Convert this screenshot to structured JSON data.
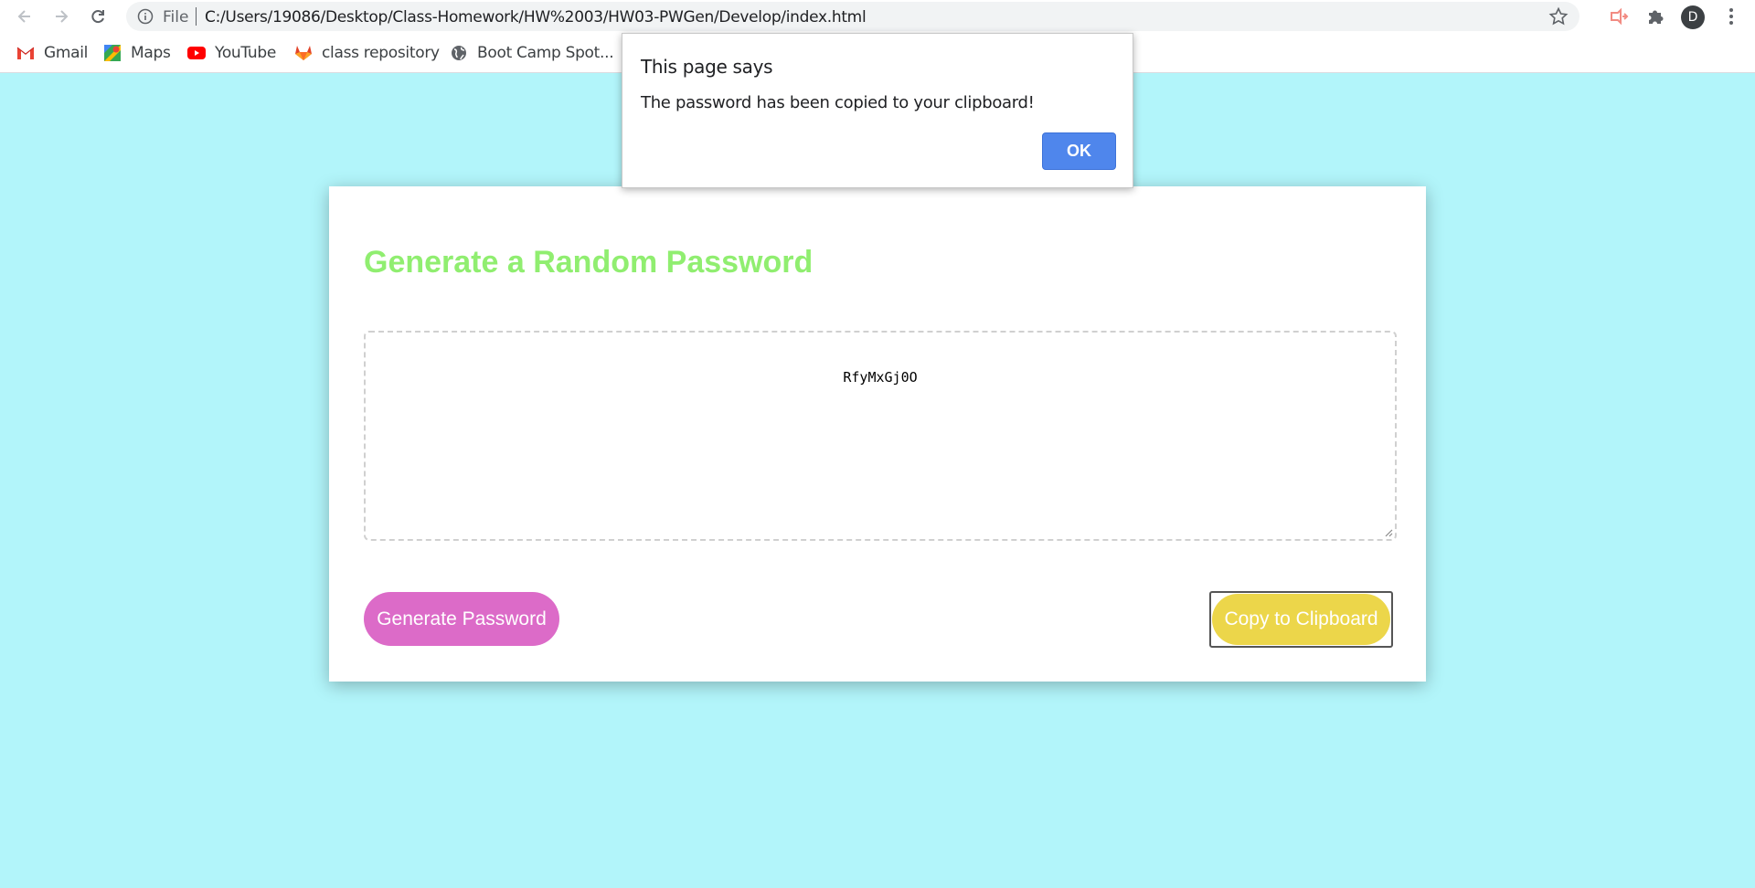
{
  "browser": {
    "url_scheme": "File",
    "url": "C:/Users/19086/Desktop/Class-Homework/HW%2003/HW03-PWGen/Develop/index.html",
    "profile_initial": "D",
    "bookmarks": [
      {
        "label": "Gmail",
        "icon": "gmail-icon"
      },
      {
        "label": "Maps",
        "icon": "maps-icon"
      },
      {
        "label": "YouTube",
        "icon": "youtube-icon"
      },
      {
        "label": "class repository",
        "icon": "gitlab-icon"
      },
      {
        "label": "Boot Camp Spot...",
        "icon": "globe-icon"
      }
    ]
  },
  "page": {
    "title": "Generate a Random Password",
    "password": "RfyMxGj0O",
    "generate_label": "Generate Password",
    "copy_label": "Copy to Clipboard",
    "colors": {
      "background": "#b2f5fa",
      "title": "#90ee70",
      "generate": "#dc6bc8",
      "copy": "#ecd64a"
    }
  },
  "dialog": {
    "title": "This page says",
    "message": "The password has been copied to your clipboard!",
    "ok_label": "OK"
  }
}
